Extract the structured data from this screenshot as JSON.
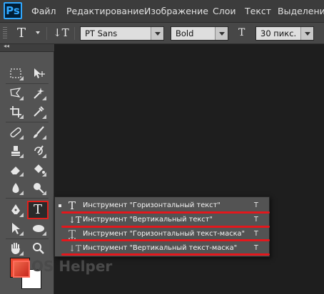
{
  "app": {
    "logo": "Ps"
  },
  "menu": [
    "Файл",
    "Редактирование",
    "Изображение",
    "Слои",
    "Текст",
    "Выделение"
  ],
  "options": {
    "tool_glyph": "T",
    "orient_glyph": "↓T",
    "font_family": "PT Sans",
    "font_style": "Bold",
    "size_glyph": "T",
    "font_size": "30 пикс."
  },
  "tools": {
    "type_tool_glyph": "T"
  },
  "colors": {
    "foreground": "#e8452e",
    "background": "#ffffff",
    "highlight": "#e4171c"
  },
  "flyout": {
    "items": [
      {
        "icon": "T",
        "label": "Инструмент \"Горизонтальный текст\"",
        "key": "T"
      },
      {
        "icon": "↓T",
        "label": "Инструмент \"Вертикальный текст\"",
        "key": "T"
      },
      {
        "icon": "T",
        "label": "Инструмент \"Горизонтальный текст-маска\"",
        "key": "T"
      },
      {
        "icon": "↓T",
        "label": "Инструмент \"Вертикальный текст-маска\"",
        "key": "T"
      }
    ]
  },
  "watermark": "OS Helper"
}
